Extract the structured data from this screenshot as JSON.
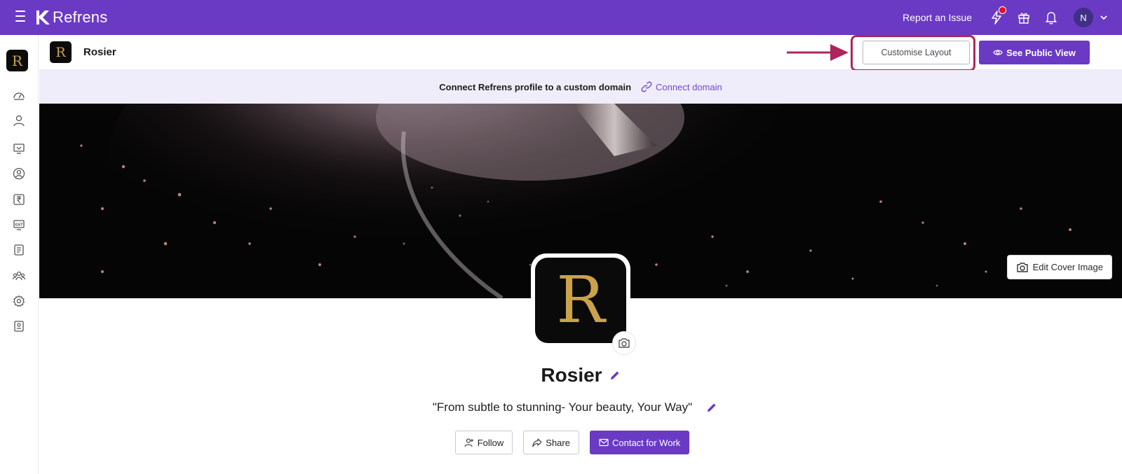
{
  "topbar": {
    "brand": "Refrens",
    "report_issue": "Report an Issue",
    "avatar_initial": "N",
    "accent": "#6a3ac5"
  },
  "sidebar": {
    "items": [
      "dashboard-icon",
      "user-icon",
      "monitor-icon",
      "account-circle-icon",
      "rupee-icon",
      "gst-icon",
      "document-icon",
      "team-icon",
      "gear-icon",
      "badge-icon"
    ]
  },
  "subheader": {
    "business_name": "Rosier",
    "customise_label": "Customise Layout",
    "public_view_label": "See Public View"
  },
  "domain_bar": {
    "text": "Connect Refrens profile to a custom domain",
    "link": "Connect domain"
  },
  "cover": {
    "edit_label": "Edit Cover Image"
  },
  "profile": {
    "name": "Rosier",
    "tagline": "\"From subtle to stunning- Your beauty, Your Way\"",
    "follow_label": "Follow",
    "share_label": "Share",
    "contact_label": "Contact for Work",
    "logo_letter": "R"
  }
}
